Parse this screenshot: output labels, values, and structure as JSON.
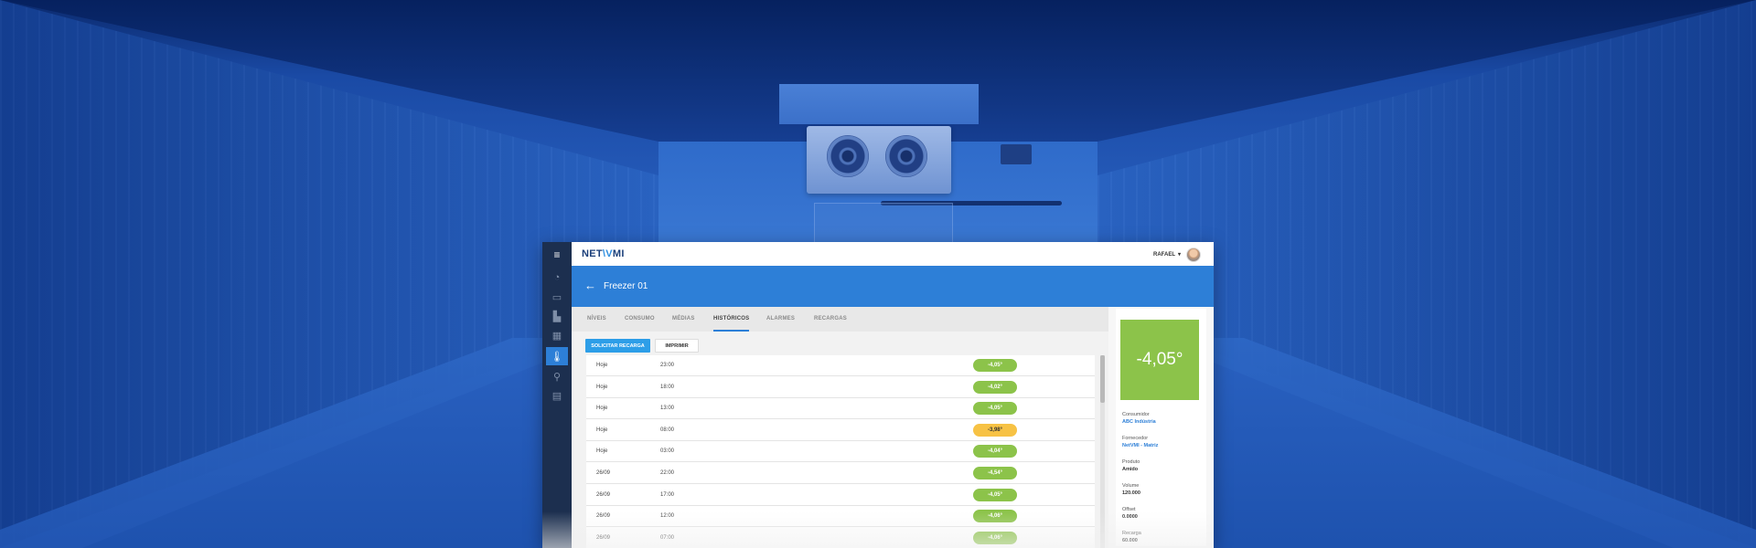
{
  "app": {
    "brand": {
      "prefix": "NET",
      "mark": "\\V",
      "suffix": "MI"
    },
    "user": {
      "name": "RAFAEL",
      "caret": "▾"
    },
    "header": {
      "back_icon": "←",
      "title": "Freezer 01"
    },
    "sidebar": {
      "menu_icon": "≡",
      "items": [
        {
          "icon": "gauge-icon",
          "glyph": "◔"
        },
        {
          "icon": "battery-icon",
          "glyph": "▭"
        },
        {
          "icon": "factory-icon",
          "glyph": "▙"
        },
        {
          "icon": "chart-icon",
          "glyph": "▦"
        },
        {
          "icon": "thermometer-icon",
          "glyph": "🌡",
          "active": true
        },
        {
          "icon": "map-pin-icon",
          "glyph": "⚲"
        },
        {
          "icon": "document-icon",
          "glyph": "▤"
        }
      ]
    },
    "tabs": [
      "NÍVEIS",
      "CONSUMO",
      "MÉDIAS",
      "HISTÓRICOS",
      "ALARMES",
      "RECARGAS"
    ],
    "active_tab": "HISTÓRICOS",
    "actions": {
      "primary": "SOLICITAR RECARGA",
      "secondary": "IMPRIMIR"
    },
    "history": [
      {
        "day": "Hoje",
        "time": "23:00",
        "temp": "-4,05°",
        "status": "ok"
      },
      {
        "day": "Hoje",
        "time": "18:00",
        "temp": "-4,02°",
        "status": "ok"
      },
      {
        "day": "Hoje",
        "time": "13:00",
        "temp": "-4,05°",
        "status": "ok"
      },
      {
        "day": "Hoje",
        "time": "08:00",
        "temp": "-3,98°",
        "status": "warn"
      },
      {
        "day": "Hoje",
        "time": "03:00",
        "temp": "-4,04°",
        "status": "ok"
      },
      {
        "day": "26/09",
        "time": "22:00",
        "temp": "-4,54°",
        "status": "ok"
      },
      {
        "day": "26/09",
        "time": "17:00",
        "temp": "-4,05°",
        "status": "ok"
      },
      {
        "day": "26/09",
        "time": "12:00",
        "temp": "-4,06°",
        "status": "ok"
      },
      {
        "day": "26/09",
        "time": "07:00",
        "temp": "-4,06°",
        "status": "ok"
      }
    ],
    "panel": {
      "current_temp": "-4,05°",
      "fields": [
        {
          "label": "Consumidor",
          "value": "ABC Indústria",
          "style": "link"
        },
        {
          "label": "Fornecedor",
          "value": "NetVMI - Matriz",
          "style": "link"
        },
        {
          "label": "Produto",
          "value": "Amido",
          "style": "dark"
        },
        {
          "label": "Volume",
          "value": "120.000",
          "style": "dark"
        },
        {
          "label": "Offset",
          "value": "0.0000",
          "style": "dark"
        },
        {
          "label": "Recarga",
          "value": "60.000",
          "style": "dark"
        }
      ]
    },
    "colors": {
      "primary": "#2d7fd7",
      "ok": "#8cc34a",
      "warn": "#f7c244",
      "sidebar": "#1c2f4f"
    }
  }
}
